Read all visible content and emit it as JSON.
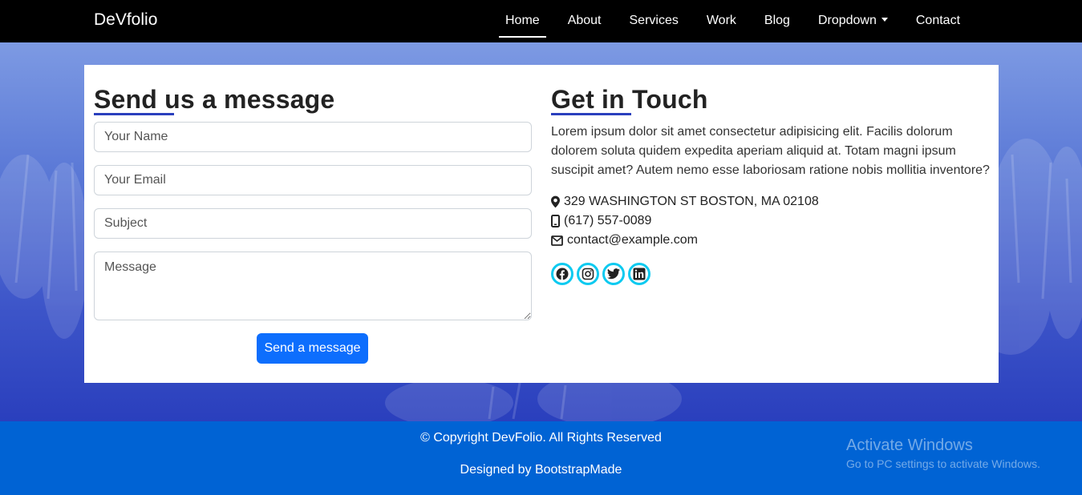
{
  "navbar": {
    "brand": "DeVfolio",
    "items": [
      {
        "label": "Home"
      },
      {
        "label": "About"
      },
      {
        "label": "Services"
      },
      {
        "label": "Work"
      },
      {
        "label": "Blog"
      },
      {
        "label": "Dropdown"
      },
      {
        "label": "Contact"
      }
    ]
  },
  "form": {
    "heading": "Send us a message",
    "name_placeholder": "Your Name",
    "email_placeholder": "Your Email",
    "subject_placeholder": "Subject",
    "message_placeholder": "Message",
    "submit_label": "Send a message"
  },
  "contact": {
    "heading": "Get in Touch",
    "description": "Lorem ipsum dolor sit amet consectetur adipisicing elit. Facilis dolorum dolorem soluta quidem expedita aperiam aliquid at. Totam magni ipsum suscipit amet? Autem nemo esse laboriosam ratione nobis mollitia inventore?",
    "address": "329 WASHINGTON ST BOSTON, MA 02108",
    "phone": "(617) 557-0089",
    "email": "contact@example.com",
    "social_icons": [
      "facebook-icon",
      "instagram-icon",
      "twitter-icon",
      "linkedin-icon"
    ]
  },
  "footer": {
    "copyright": "© Copyright DevFolio. All Rights Reserved",
    "credit": "Designed by BootstrapMade"
  },
  "watermark": {
    "title": "Activate Windows",
    "subtitle": "Go to PC settings to activate Windows."
  },
  "colors": {
    "accent": "#0d6efd",
    "footer": "#0063d4",
    "social_ring": "#0dcaf0",
    "navbar": "#000000"
  }
}
